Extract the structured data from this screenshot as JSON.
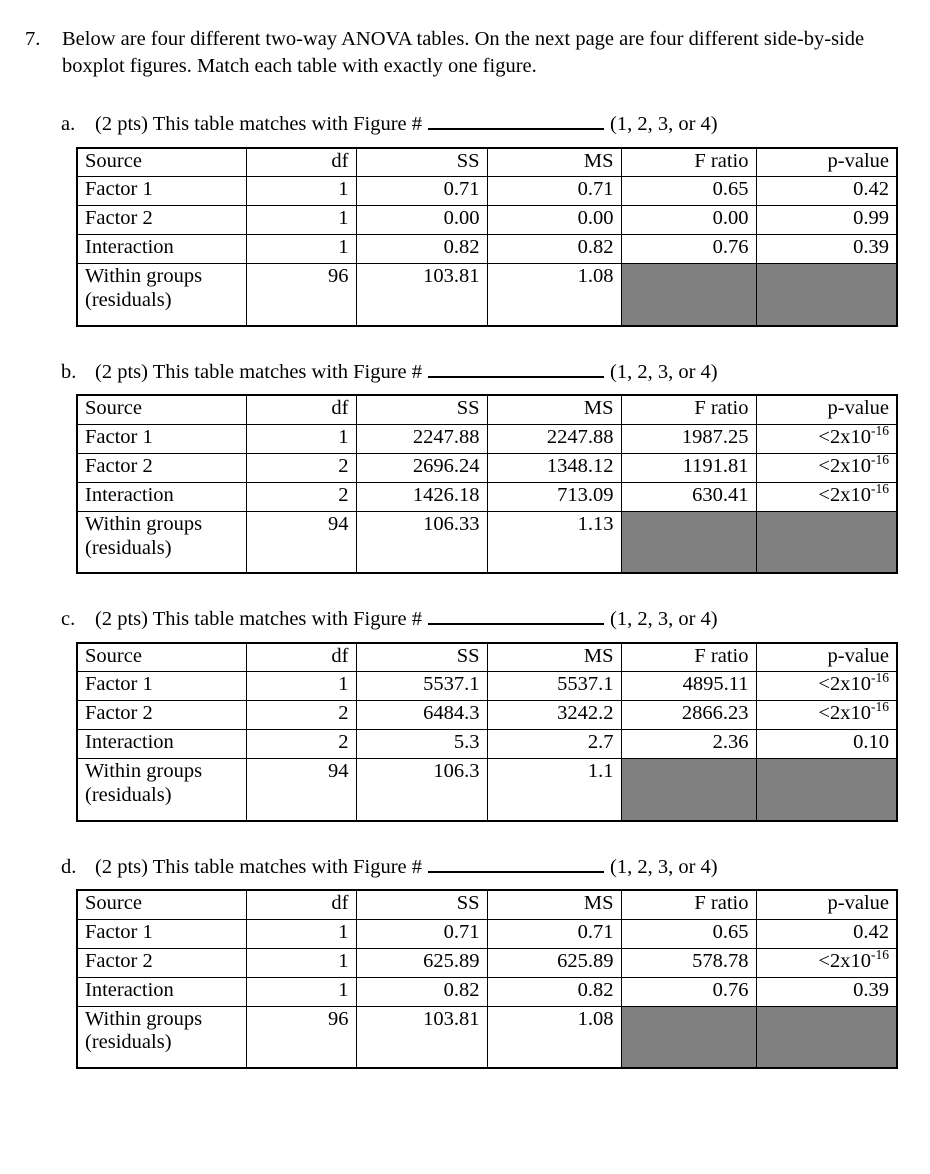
{
  "question": {
    "number": "7.",
    "text": "Below are four different two-way ANOVA tables. On the next page are four different side-by-side boxplot figures. Match each table with exactly one figure."
  },
  "prompt_template": {
    "points": "(2 pts)",
    "prompt": "(2 pts) This table matches with Figure #",
    "suffix": "(1, 2, 3, or 4)",
    "answer_value": ""
  },
  "columns": [
    "Source",
    "df",
    "SS",
    "MS",
    "F ratio",
    "p-value"
  ],
  "row_labels": {
    "factor1": "Factor 1",
    "factor2": "Factor 2",
    "interaction": "Interaction",
    "residual_line1": "Within groups",
    "residual_line2": "(residuals)"
  },
  "colors": {
    "shaded_cell": "#808080",
    "border": "#000000",
    "text": "#000000",
    "page_background": "#ffffff"
  },
  "parts": [
    {
      "letter": "a.",
      "prompt": "(2 pts) This table matches with Figure #",
      "suffix": "(1, 2, 3, or 4)",
      "answer_value": "",
      "table": {
        "headers": [
          "Source",
          "df",
          "SS",
          "MS",
          "F ratio",
          "p-value"
        ],
        "rows": [
          {
            "source": "Factor 1",
            "df": "1",
            "ss": "0.71",
            "ms": "0.71",
            "f": "0.65",
            "p_base": "0.42",
            "p_exp": ""
          },
          {
            "source": "Factor 2",
            "df": "1",
            "ss": "0.00",
            "ms": "0.00",
            "f": "0.00",
            "p_base": "0.99",
            "p_exp": ""
          },
          {
            "source": "Interaction",
            "df": "1",
            "ss": "0.82",
            "ms": "0.82",
            "f": "0.76",
            "p_base": "0.39",
            "p_exp": ""
          }
        ],
        "residual": {
          "source_line1": "Within groups",
          "source_line2": "(residuals)",
          "df": "96",
          "ss": "103.81",
          "ms": "1.08",
          "f": "",
          "p_base": "",
          "p_exp": ""
        }
      }
    },
    {
      "letter": "b.",
      "prompt": "(2 pts) This table matches with Figure #",
      "suffix": "(1, 2, 3, or 4)",
      "answer_value": "",
      "table": {
        "headers": [
          "Source",
          "df",
          "SS",
          "MS",
          "F ratio",
          "p-value"
        ],
        "rows": [
          {
            "source": "Factor 1",
            "df": "1",
            "ss": "2247.88",
            "ms": "2247.88",
            "f": "1987.25",
            "p_base": "<2x10",
            "p_exp": "-16"
          },
          {
            "source": "Factor 2",
            "df": "2",
            "ss": "2696.24",
            "ms": "1348.12",
            "f": "1191.81",
            "p_base": "<2x10",
            "p_exp": "-16"
          },
          {
            "source": "Interaction",
            "df": "2",
            "ss": "1426.18",
            "ms": "713.09",
            "f": "630.41",
            "p_base": "<2x10",
            "p_exp": "-16"
          }
        ],
        "residual": {
          "source_line1": "Within groups",
          "source_line2": "(residuals)",
          "df": "94",
          "ss": "106.33",
          "ms": "1.13",
          "f": "",
          "p_base": "",
          "p_exp": ""
        }
      }
    },
    {
      "letter": "c.",
      "prompt": "(2 pts) This table matches with Figure #",
      "suffix": "(1, 2, 3, or 4)",
      "answer_value": "",
      "table": {
        "headers": [
          "Source",
          "df",
          "SS",
          "MS",
          "F ratio",
          "p-value"
        ],
        "rows": [
          {
            "source": "Factor 1",
            "df": "1",
            "ss": "5537.1",
            "ms": "5537.1",
            "f": "4895.11",
            "p_base": "<2x10",
            "p_exp": "-16"
          },
          {
            "source": "Factor 2",
            "df": "2",
            "ss": "6484.3",
            "ms": "3242.2",
            "f": "2866.23",
            "p_base": "<2x10",
            "p_exp": "-16"
          },
          {
            "source": "Interaction",
            "df": "2",
            "ss": "5.3",
            "ms": "2.7",
            "f": "2.36",
            "p_base": "0.10",
            "p_exp": ""
          }
        ],
        "residual": {
          "source_line1": "Within groups",
          "source_line2": "(residuals)",
          "df": "94",
          "ss": "106.3",
          "ms": "1.1",
          "f": "",
          "p_base": "",
          "p_exp": ""
        }
      }
    },
    {
      "letter": "d.",
      "prompt": "(2 pts) This table matches with Figure #",
      "suffix": "(1, 2, 3, or 4)",
      "answer_value": "",
      "table": {
        "headers": [
          "Source",
          "df",
          "SS",
          "MS",
          "F ratio",
          "p-value"
        ],
        "rows": [
          {
            "source": "Factor 1",
            "df": "1",
            "ss": "0.71",
            "ms": "0.71",
            "f": "0.65",
            "p_base": "0.42",
            "p_exp": ""
          },
          {
            "source": "Factor 2",
            "df": "1",
            "ss": "625.89",
            "ms": "625.89",
            "f": "578.78",
            "p_base": "<2x10",
            "p_exp": "-16"
          },
          {
            "source": "Interaction",
            "df": "1",
            "ss": "0.82",
            "ms": "0.82",
            "f": "0.76",
            "p_base": "0.39",
            "p_exp": ""
          }
        ],
        "residual": {
          "source_line1": "Within groups",
          "source_line2": "(residuals)",
          "df": "96",
          "ss": "103.81",
          "ms": "1.08",
          "f": "",
          "p_base": "",
          "p_exp": ""
        }
      }
    }
  ]
}
